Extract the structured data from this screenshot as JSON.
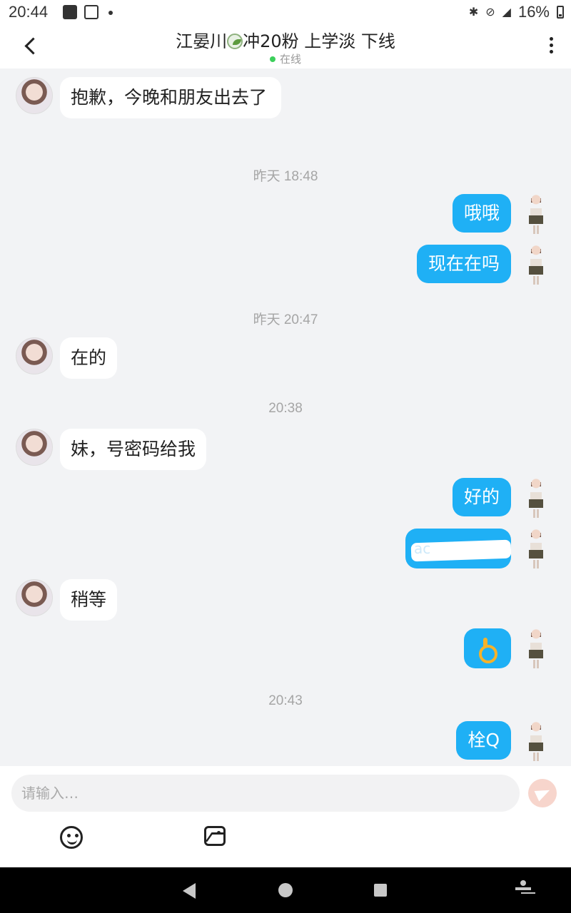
{
  "status_bar": {
    "time": "20:44",
    "battery": "16%"
  },
  "header": {
    "title_prefix": "江晏川",
    "title_suffix": "冲20粉 上学淡 下线",
    "presence": "在线"
  },
  "messages": [
    {
      "side": "in",
      "text": "抱歉，今晚和朋友出去了"
    },
    {
      "timestamp": "昨天 18:48"
    },
    {
      "side": "out",
      "text": "哦哦"
    },
    {
      "side": "out",
      "text": "现在在吗"
    },
    {
      "timestamp": "昨天 20:47"
    },
    {
      "side": "in",
      "text": "在的"
    },
    {
      "timestamp": "20:38"
    },
    {
      "side": "in",
      "text": "妹，号密码给我"
    },
    {
      "side": "out",
      "text": "好的"
    },
    {
      "side": "out",
      "text": "ac",
      "redacted": true
    },
    {
      "side": "in",
      "text": "稍等"
    },
    {
      "side": "out",
      "emoji": "ok-hand"
    },
    {
      "timestamp": "20:43"
    },
    {
      "side": "out",
      "text": "栓Q"
    }
  ],
  "composer": {
    "placeholder": "请输入…"
  },
  "colors": {
    "outgoing_bubble": "#1fb0f5",
    "incoming_bubble": "#ffffff",
    "background": "#f2f3f5",
    "online_dot": "#3ccf5b"
  }
}
